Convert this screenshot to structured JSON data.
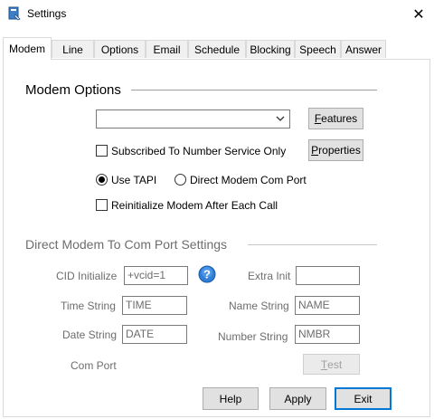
{
  "window": {
    "title": "Settings",
    "close_glyph": "✕"
  },
  "tabs": [
    {
      "label": "Modem",
      "active": true
    },
    {
      "label": "Line"
    },
    {
      "label": "Options"
    },
    {
      "label": "Email"
    },
    {
      "label": "Schedule"
    },
    {
      "label": "Blocking"
    },
    {
      "label": "Speech"
    },
    {
      "label": "Answer"
    }
  ],
  "modem_options": {
    "title": "Modem Options",
    "modem_select_value": "",
    "features_button": {
      "pre": "",
      "u": "F",
      "post": "eatures"
    },
    "properties_button": {
      "pre": "",
      "u": "P",
      "post": "roperties"
    },
    "subscribed_label": "Subscribed To Number Service Only",
    "subscribed_checked": false,
    "use_tapi_label": "Use TAPI",
    "use_tapi_selected": true,
    "direct_modem_label": "Direct Modem Com Port",
    "direct_modem_selected": false,
    "reinitialize_label": "Reinitialize Modem After Each Call",
    "reinitialize_checked": false
  },
  "direct_settings": {
    "title": "Direct Modem To Com Port Settings",
    "cid_initialize_label": "CID Initialize",
    "cid_initialize_value": "+vcid=1",
    "extra_init_label": "Extra Init",
    "extra_init_value": "",
    "time_string_label": "Time String",
    "time_string_value": "TIME",
    "name_string_label": "Name String",
    "name_string_value": "NAME",
    "date_string_label": "Date String",
    "date_string_value": "DATE",
    "number_string_label": "Number String",
    "number_string_value": "NMBR",
    "com_port_label": "Com Port",
    "test_button": {
      "pre": "",
      "u": "T",
      "post": "est"
    },
    "help_glyph": "?"
  },
  "footer": {
    "help_label": "Help",
    "apply_label": "Apply",
    "exit_label": "Exit"
  },
  "colors": {
    "accent": "#0078d7",
    "help_icon": "#2f7fd6"
  },
  "icons": {
    "app": "settings-app-icon",
    "help": "help-icon",
    "dropdown": "chevron-down-icon",
    "close": "close-icon"
  }
}
